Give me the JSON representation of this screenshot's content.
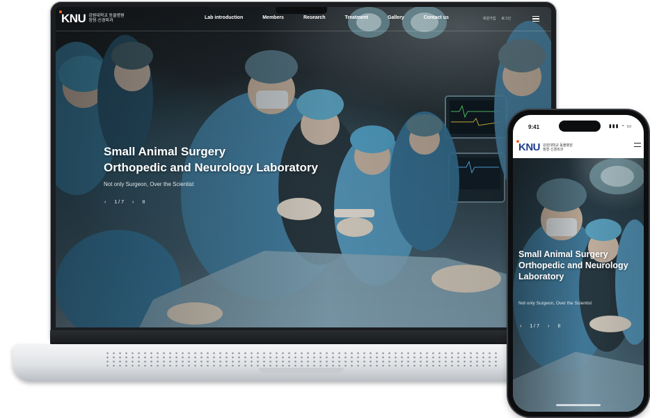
{
  "site": {
    "logo": {
      "mark": "KNU",
      "line1": "강원대학교 동물병원",
      "line2": "정형·신경외과"
    },
    "nav": {
      "items": [
        "Lab introduction",
        "Members",
        "Research",
        "Treatment",
        "Gallery",
        "Contact us"
      ],
      "util": [
        "회원가입",
        "로그인"
      ]
    },
    "hero": {
      "title_line1": "Small Animal Surgery",
      "title_line2": "Orthopedic and Neurology Laboratory",
      "subtitle": "Not only Surgeon, Over the Scientist",
      "slider": {
        "prev": "‹",
        "counter": "1 / 7",
        "next": "›",
        "pause": "II"
      }
    }
  },
  "phone": {
    "status": {
      "time": "9:41",
      "icons": "▮▮▮ ◔ ▭"
    },
    "hero": {
      "title_line1": "Small Animal Surgery",
      "title_line2": "Orthopedic and Neurology",
      "title_line3": "Laboratory"
    }
  },
  "colors": {
    "brand_navy": "#1c3d8f",
    "accent_orange": "#f26a2e",
    "scrub_teal": "#5a8ca5"
  }
}
